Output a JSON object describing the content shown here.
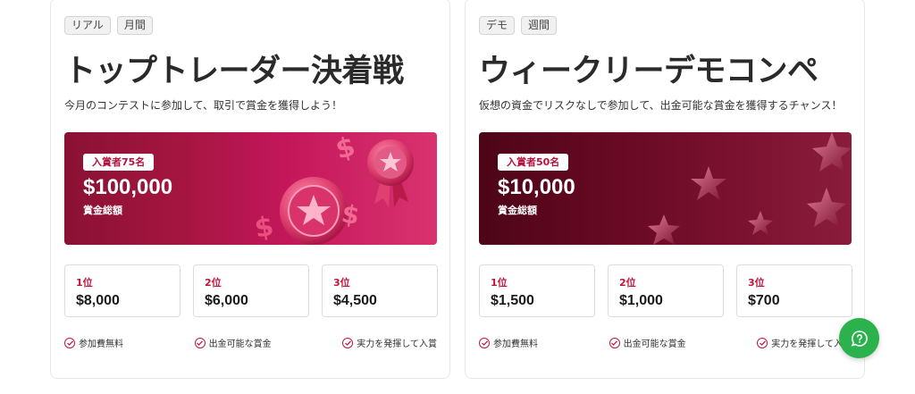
{
  "cards": [
    {
      "tags": [
        "リアル",
        "月間"
      ],
      "title": "トップトレーダー決着戦",
      "description": "今月のコンテストに参加して、取引で賞金を獲得しよう！",
      "banner": {
        "badge": "入賞者75名",
        "amount": "$100,000",
        "amount_label": "賞金総額",
        "decoration": "coin-medal-dollar-icons"
      },
      "prizes": [
        {
          "rank": "1位",
          "value": "$8,000"
        },
        {
          "rank": "2位",
          "value": "$6,000"
        },
        {
          "rank": "3位",
          "value": "$4,500"
        }
      ],
      "features": [
        "参加費無料",
        "出金可能な賞金",
        "実力を発揮して入賞"
      ]
    },
    {
      "tags": [
        "デモ",
        "週間"
      ],
      "title": "ウィークリーデモコンペ",
      "description": "仮想の資金でリスクなしで参加して、出金可能な賞金を獲得するチャンス！",
      "banner": {
        "badge": "入賞者50名",
        "amount": "$10,000",
        "amount_label": "賞金総額",
        "decoration": "star-icons"
      },
      "prizes": [
        {
          "rank": "1位",
          "value": "$1,500"
        },
        {
          "rank": "2位",
          "value": "$1,000"
        },
        {
          "rank": "3位",
          "value": "$700"
        }
      ],
      "features": [
        "参加費無料",
        "出金可能な賞金",
        "実力を発揮して入賞"
      ]
    }
  ],
  "chat": {
    "icon": "chat-help-icon",
    "color": "#2bb24c"
  },
  "colors": {
    "accent": "#c0143c",
    "banner_1": "#c4175b",
    "banner_2": "#6a0a24"
  }
}
